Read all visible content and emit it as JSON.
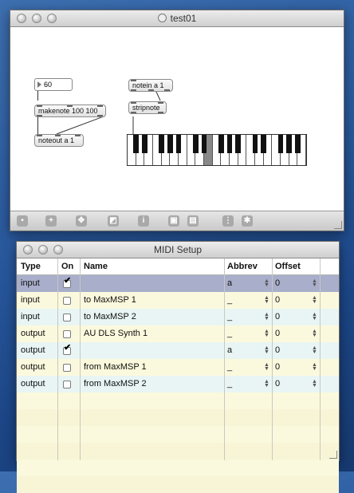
{
  "patcher": {
    "title": "test01",
    "objects": {
      "number": "60",
      "makenote": "makenote 100 100",
      "noteout": "noteout a 1",
      "notein": "notein a 1",
      "stripnote": "stripnote"
    },
    "toolbar_icons": [
      "lock-icon",
      "add-object-icon",
      "move-icon",
      "presentation-icon",
      "info-icon",
      "clipboard-icon",
      "copy-icon",
      "grid-icon",
      "settings-icon"
    ],
    "keyboard": {
      "white_keys": 21,
      "highlighted_key": "middle-c"
    }
  },
  "midi_setup": {
    "title": "MIDI Setup",
    "columns": [
      "Type",
      "On",
      "Name",
      "Abbrev",
      "Offset"
    ],
    "rows": [
      {
        "type": "input",
        "on": true,
        "name": "",
        "abbrev": "a",
        "offset": "0",
        "selected": true
      },
      {
        "type": "input",
        "on": false,
        "name": "to MaxMSP 1",
        "abbrev": "_",
        "offset": "0",
        "selected": false
      },
      {
        "type": "input",
        "on": false,
        "name": "to MaxMSP 2",
        "abbrev": "_",
        "offset": "0",
        "selected": false
      },
      {
        "type": "output",
        "on": false,
        "name": "AU DLS Synth 1",
        "abbrev": "_",
        "offset": "0",
        "selected": false
      },
      {
        "type": "output",
        "on": true,
        "name": "",
        "abbrev": "a",
        "offset": "0",
        "selected": false
      },
      {
        "type": "output",
        "on": false,
        "name": "from MaxMSP 1",
        "abbrev": "_",
        "offset": "0",
        "selected": false
      },
      {
        "type": "output",
        "on": false,
        "name": "from MaxMSP 2",
        "abbrev": "_",
        "offset": "0",
        "selected": false
      }
    ],
    "colors": {
      "selected_row": "#a9aecb",
      "row_a": "#fbf9dd",
      "row_b": "#e8f5f4",
      "accent_row": "#eaffff"
    }
  }
}
